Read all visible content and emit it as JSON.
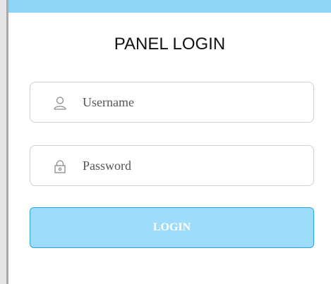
{
  "title": "PANEL LOGIN",
  "username": {
    "placeholder": "Username",
    "icon": "user-icon"
  },
  "password": {
    "placeholder": "Password",
    "icon": "lock-icon"
  },
  "login_button": {
    "label": "LOGIN"
  },
  "colors": {
    "accent": "#8fd4f5",
    "button_fill": "#9ddcfb",
    "button_border": "#2ea3e0",
    "field_border": "#cfcfcf"
  }
}
